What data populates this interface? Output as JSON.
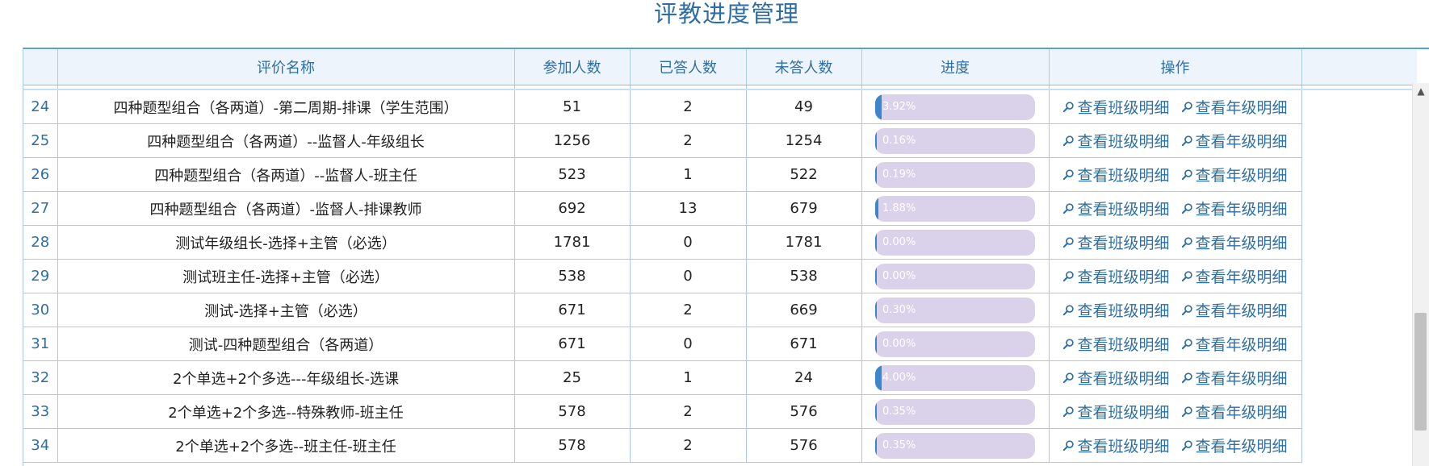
{
  "page": {
    "title": "评教进度管理"
  },
  "table": {
    "headers": {
      "num": "",
      "name": "评价名称",
      "join": "参加人数",
      "done": "已答人数",
      "left": "未答人数",
      "progress": "进度",
      "ops": "操作",
      "extra": ""
    },
    "rows": [
      {
        "num": "24",
        "name": "四种题型组合（各两道）-第二周期-排课（学生范围）",
        "join": "51",
        "done": "2",
        "left": "49",
        "progress_text": "3.92%",
        "progress_value": 3.92
      },
      {
        "num": "25",
        "name": "四种题型组合（各两道）--监督人-年级组长",
        "join": "1256",
        "done": "2",
        "left": "1254",
        "progress_text": "0.16%",
        "progress_value": 0.16
      },
      {
        "num": "26",
        "name": "四种题型组合（各两道）--监督人-班主任",
        "join": "523",
        "done": "1",
        "left": "522",
        "progress_text": "0.19%",
        "progress_value": 0.19
      },
      {
        "num": "27",
        "name": "四种题型组合（各两道）-监督人-排课教师",
        "join": "692",
        "done": "13",
        "left": "679",
        "progress_text": "1.88%",
        "progress_value": 1.88
      },
      {
        "num": "28",
        "name": "测试年级组长-选择+主管（必选）",
        "join": "1781",
        "done": "0",
        "left": "1781",
        "progress_text": "0.00%",
        "progress_value": 0
      },
      {
        "num": "29",
        "name": "测试班主任-选择+主管（必选）",
        "join": "538",
        "done": "0",
        "left": "538",
        "progress_text": "0.00%",
        "progress_value": 0
      },
      {
        "num": "30",
        "name": "测试-选择+主管（必选）",
        "join": "671",
        "done": "2",
        "left": "669",
        "progress_text": "0.30%",
        "progress_value": 0.3
      },
      {
        "num": "31",
        "name": "测试-四种题型组合（各两道）",
        "join": "671",
        "done": "0",
        "left": "671",
        "progress_text": "0.00%",
        "progress_value": 0
      },
      {
        "num": "32",
        "name": "2个单选+2个多选---年级组长-选课",
        "join": "25",
        "done": "1",
        "left": "24",
        "progress_text": "4.00%",
        "progress_value": 4.0
      },
      {
        "num": "33",
        "name": "2个单选+2个多选--特殊教师-班主任",
        "join": "578",
        "done": "2",
        "left": "576",
        "progress_text": "0.35%",
        "progress_value": 0.35
      },
      {
        "num": "34",
        "name": "2个单选+2个多选--班主任-班主任",
        "join": "578",
        "done": "2",
        "left": "576",
        "progress_text": "0.35%",
        "progress_value": 0.35
      }
    ]
  },
  "actions": {
    "class_detail": "查看班级明细",
    "grade_detail": "查看年级明细",
    "icon": "magnifier-icon"
  },
  "colors": {
    "accent": "#2f6fa3",
    "progress_track": "#dad1ea",
    "progress_fill": "#3b86cc",
    "header_bg": "#edf4fb"
  }
}
